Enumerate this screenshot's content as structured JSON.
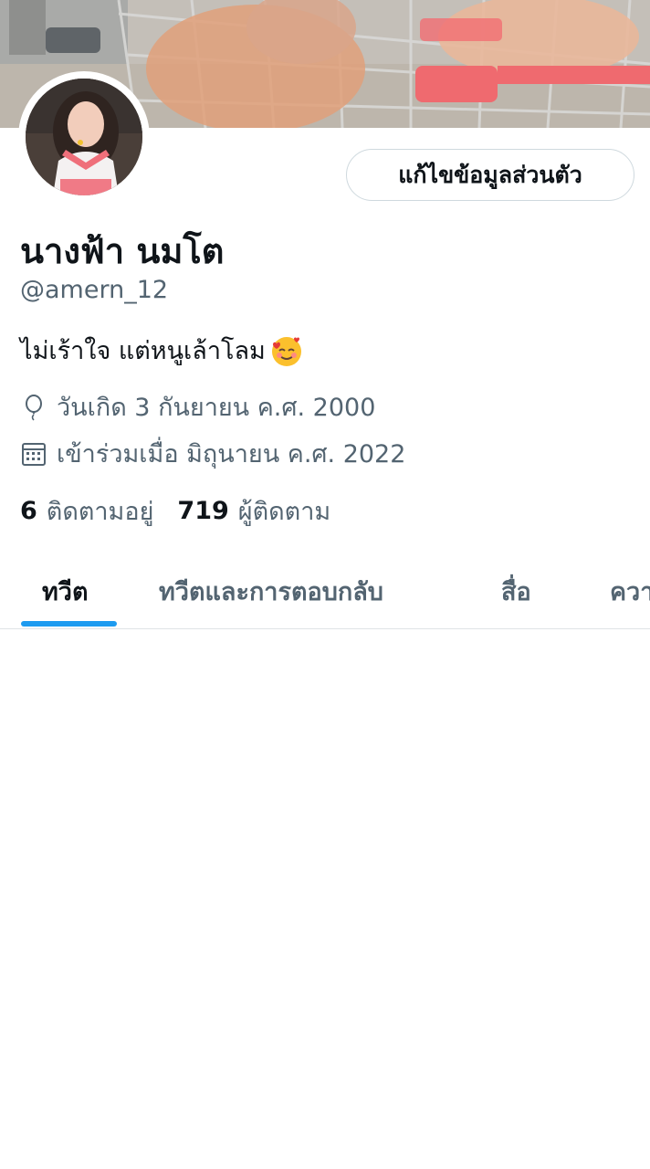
{
  "profile": {
    "display_name": "นางฟ้า นมโต",
    "handle": "@amern_12",
    "bio": "ไม่เร้าใจ แต่หนูเล้าโลม",
    "bio_emoji": "smiling-face-with-hearts",
    "birthday": "วันเกิด 3 กันยายน ค.ศ. 2000",
    "joined": "เข้าร่วมเมื่อ มิถุนายน ค.ศ. 2022"
  },
  "actions": {
    "edit_profile_label": "แก้ไขข้อมูลส่วนตัว"
  },
  "stats": {
    "following_count": "6",
    "following_label": "ติดตามอยู่",
    "followers_count": "719",
    "followers_label": "ผู้ติดตาม"
  },
  "tabs": [
    {
      "label": "ทวีต",
      "active": true
    },
    {
      "label": "ทวีตและการตอบกลับ",
      "active": false
    },
    {
      "label": "สื่อ",
      "active": false
    },
    {
      "label": "ความ",
      "active": false
    }
  ],
  "colors": {
    "accent": "#1d9bf0",
    "text": "#0f1419",
    "secondary": "#536471",
    "border": "#cfd9de"
  }
}
